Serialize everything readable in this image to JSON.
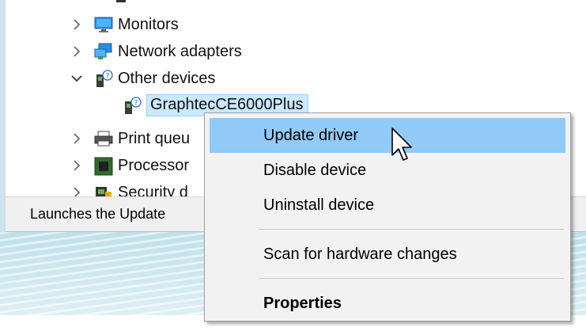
{
  "device_tree": {
    "items": [
      {
        "label": "Monitors",
        "icon": "monitor-icon",
        "expander": "collapsed"
      },
      {
        "label": "Network adapters",
        "icon": "network-adapter-icon",
        "expander": "collapsed"
      },
      {
        "label": "Other devices",
        "icon": "unknown-device-icon",
        "expander": "expanded"
      },
      {
        "label": "GraphtecCE6000Plus",
        "icon": "unknown-device-icon",
        "expander": "none",
        "selected": true
      },
      {
        "label": "Print queu",
        "icon": "printer-icon",
        "expander": "collapsed"
      },
      {
        "label": "Processor",
        "icon": "processor-icon",
        "expander": "collapsed"
      },
      {
        "label": "Security d",
        "icon": "security-device-icon",
        "expander": "collapsed"
      }
    ]
  },
  "status_bar": {
    "text": "Launches the Update"
  },
  "context_menu": {
    "items": [
      {
        "label": "Update driver",
        "highlighted": true
      },
      {
        "label": "Disable device"
      },
      {
        "label": "Uninstall device"
      },
      {
        "label": "Scan for hardware changes"
      },
      {
        "label": "Properties",
        "bold": true
      }
    ]
  },
  "colors": {
    "menu_highlight": "#91c9f7",
    "selection": "#cce8ff",
    "statusbar": "#f0f0f0"
  }
}
